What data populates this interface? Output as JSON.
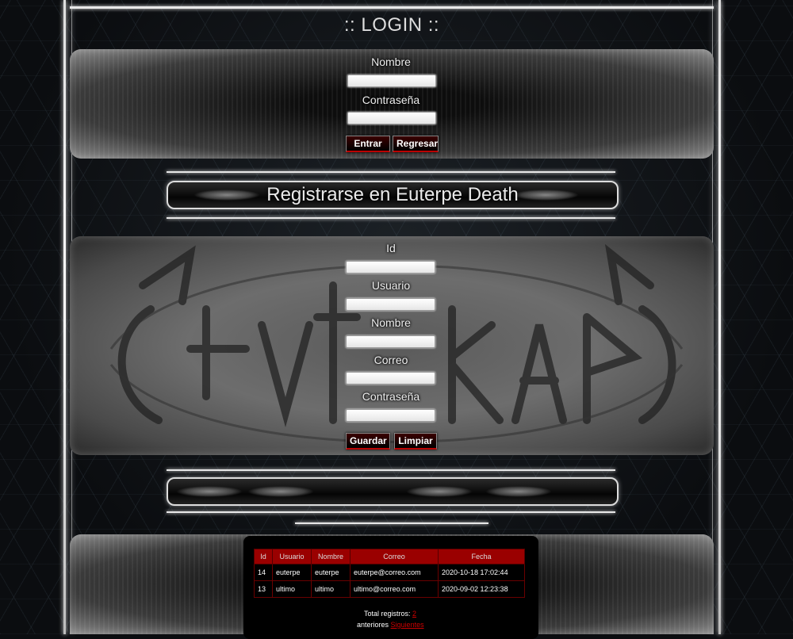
{
  "login": {
    "title": ":: LOGIN ::",
    "name_label": "Nombre",
    "password_label": "Contraseña",
    "enter_button": "Entrar",
    "back_button": "Regresar"
  },
  "register": {
    "title": "Registrarse en Euterpe Death",
    "id_label": "Id",
    "user_label": "Usuario",
    "name_label": "Nombre",
    "email_label": "Correo",
    "password_label": "Contraseña",
    "save_button": "Guardar",
    "clear_button": "Limpiar"
  },
  "records": {
    "headers": [
      "Id",
      "Usuario",
      "Nombre",
      "Correo",
      "Fecha"
    ],
    "rows": [
      [
        "14",
        "euterpe",
        "euterpe",
        "euterpe@correo.com",
        "2020-10-18 17:02:44"
      ],
      [
        "13",
        "ultimo",
        "ultimo",
        "ultimo@correo.com",
        "2020-09-02 12:23:38"
      ]
    ],
    "total_label": "Total registros:",
    "total_value": "2",
    "prev_label": "anteriores",
    "next_label": "Siguientes"
  },
  "colors": {
    "accent_red": "#9a0000",
    "frame_white": "#e8e8e8",
    "background": "#0b0d10"
  }
}
